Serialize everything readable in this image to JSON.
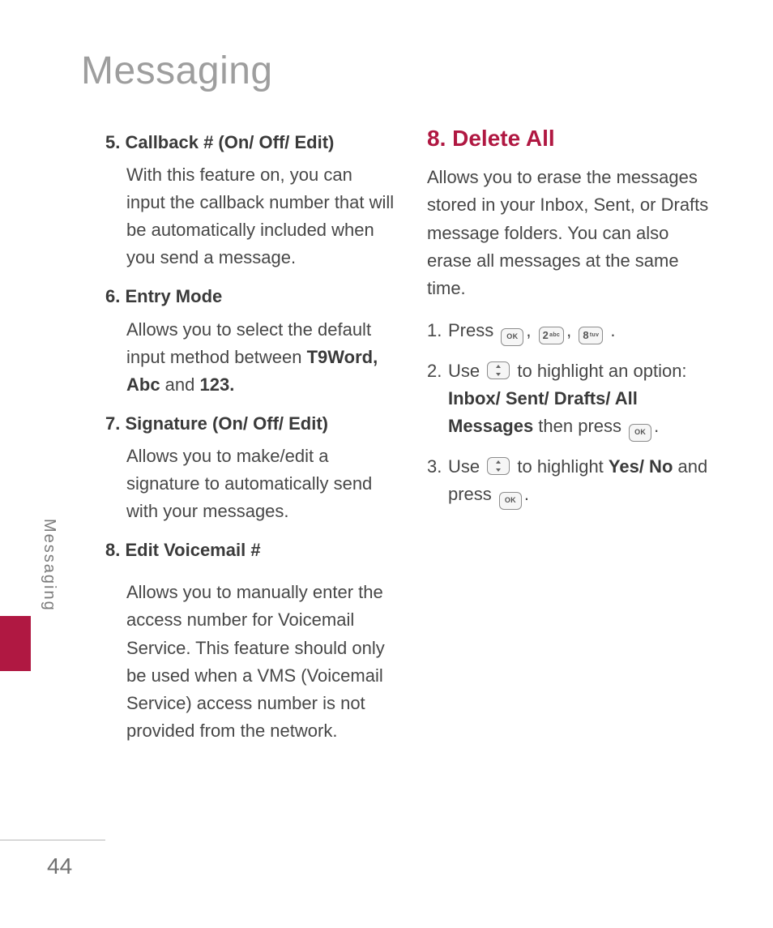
{
  "chapter_title": "Messaging",
  "side_label": "Messaging",
  "page_number": "44",
  "left": {
    "item5": {
      "title": "5. Callback # (On/ Off/ Edit)",
      "body": "With this feature on, you can input the callback number that will be automatically included when you send a message."
    },
    "item6": {
      "title": "6. Entry Mode",
      "body_pre": "Allows you to select the default input method between ",
      "body_bold": "T9Word, Abc",
      "body_mid": " and ",
      "body_bold2": "123."
    },
    "item7": {
      "title": "7. Signature (On/ Off/ Edit)",
      "body": "Allows you to make/edit a signature to automatically send with your messages."
    },
    "item8": {
      "title": "8. Edit Voicemail #",
      "body": "Allows you to manually enter the access number for Voicemail Service. This feature should only be used when a VMS (Voicemail Service) access number is not provided from the network."
    }
  },
  "right": {
    "heading": "8. Delete All",
    "intro": "Allows you to erase the messages stored in your Inbox, Sent, or Drafts message folders. You can also erase all messages at the same time.",
    "step1": {
      "num": "1.",
      "pre": "Press ",
      "key2_digit": "2",
      "key2_letters": "abc",
      "key8_digit": "8",
      "key8_letters": "tuv",
      "post": "."
    },
    "step2": {
      "num": "2.",
      "pre": "Use ",
      "mid": " to highlight an option: ",
      "bold": "Inbox/ Sent/ Drafts/ All Messages",
      "mid2": " then press ",
      "post": "."
    },
    "step3": {
      "num": "3.",
      "pre": "Use ",
      "mid": " to highlight ",
      "bold": "Yes/ No",
      "mid2": " and press ",
      "post": "."
    }
  }
}
